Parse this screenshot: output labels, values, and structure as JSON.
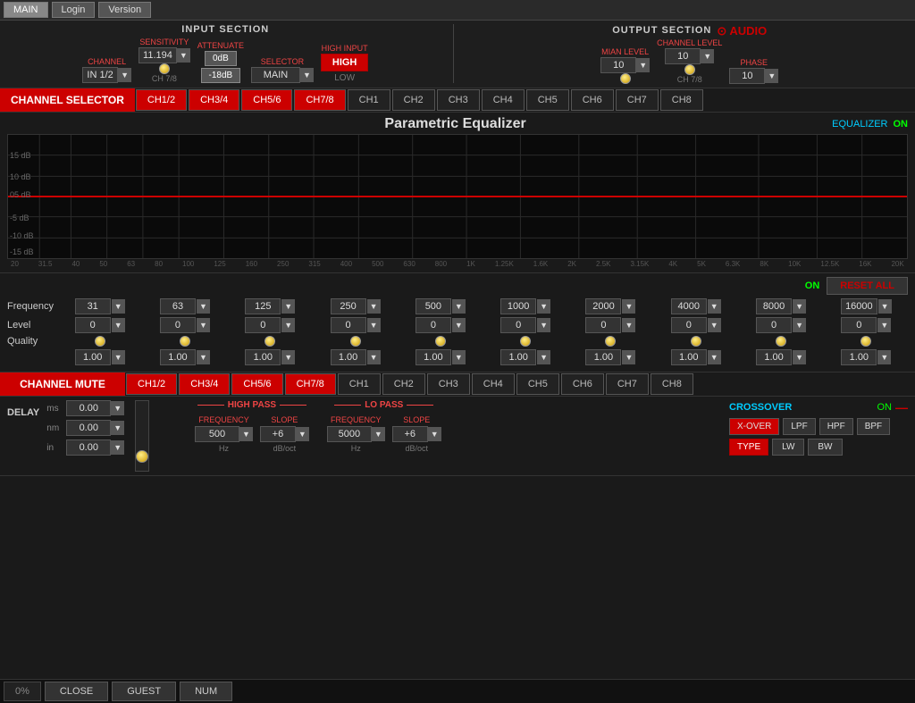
{
  "nav": {
    "main": "MAIN",
    "login": "Login",
    "version": "Version"
  },
  "input_section": {
    "title": "INPUT SECTION",
    "channel_label": "CHANNEL",
    "channel_value": "IN 1/2",
    "sensitivity_label": "SENSITIVITY",
    "sensitivity_value": "11.194",
    "attenuate_label": "ATTENUATE",
    "att_0db": "0dB",
    "att_neg18db": "-18dB",
    "selector_label": "SELECTOR",
    "selector_value": "MAIN",
    "high_input_label": "HIGH INPUT",
    "high_value": "HIGH",
    "low_value": "LOW",
    "ch78_label": "CH 7/8"
  },
  "output_section": {
    "title": "OUTPUT SECTION",
    "audio_logo": "⊙ AUDIO",
    "mian_level_label": "MIAN LEVEL",
    "mian_level_value": "10",
    "channel_level_label": "CHANNEL LEVEL",
    "channel_level_value": "10",
    "phase_label": "PHASE",
    "phase_value": "10",
    "ch78_label": "CH 7/8"
  },
  "channel_selector": {
    "label": "CHANNEL SELECTOR",
    "buttons": [
      "CH1/2",
      "CH3/4",
      "CH5/6",
      "CH7/8",
      "CH1",
      "CH2",
      "CH3",
      "CH4",
      "CH5",
      "CH6",
      "CH7",
      "CH8"
    ]
  },
  "equalizer": {
    "title": "Parametric Equalizer",
    "eq_label": "EQUALIZER",
    "on_label": "ON",
    "freq_labels": [
      "20",
      "31.5",
      "40",
      "50",
      "63",
      "80",
      "100",
      "125",
      "160",
      "250",
      "315",
      "400",
      "500",
      "630",
      "800",
      "1K",
      "1.25K",
      "1.6K",
      "2K",
      "2.5K",
      "3.15K",
      "4K",
      "5K",
      "6.3K",
      "8K",
      "10K",
      "12.5K",
      "16K",
      "20K"
    ],
    "db_labels": [
      "15 dB",
      "10 dB",
      "05 dB",
      "-5 dB",
      "-10 dB",
      "-15 dB"
    ],
    "controls": {
      "on_label": "ON",
      "reset_all": "RESET ALL",
      "frequency_label": "Frequency",
      "frequencies": [
        "31",
        "63",
        "125",
        "250",
        "500",
        "1000",
        "2000",
        "4000",
        "8000",
        "16000"
      ],
      "level_label": "Level",
      "levels": [
        "0",
        "0",
        "0",
        "0",
        "0",
        "0",
        "0",
        "0",
        "0",
        "0"
      ],
      "quality_label": "Quality",
      "qualities": [
        "1.00",
        "1.00",
        "1.00",
        "1.00",
        "1.00",
        "1.00",
        "1.00",
        "1.00",
        "1.00",
        "1.00"
      ]
    }
  },
  "channel_mute": {
    "label": "CHANNEL MUTE",
    "buttons": [
      "CH1/2",
      "CH3/4",
      "CH5/6",
      "CH7/8",
      "CH1",
      "CH2",
      "CH3",
      "CH4",
      "CH5",
      "CH6",
      "CH7",
      "CH8"
    ]
  },
  "delay": {
    "label": "DELAY",
    "ms_label": "ms",
    "ms_value": "0.00",
    "nm_label": "nm",
    "nm_value": "0.00",
    "in_label": "in",
    "in_value": "0.00"
  },
  "high_pass": {
    "title": "HIGH PASS",
    "freq_label": "FREQUENCY",
    "freq_value": "500",
    "freq_unit": "Hz",
    "slope_label": "SLOPE",
    "slope_value": "+6",
    "slope_unit": "dB/oct"
  },
  "lo_pass": {
    "title": "LO PASS",
    "freq_label": "FREQUENCY",
    "freq_value": "5000",
    "freq_unit": "Hz",
    "slope_label": "SLOPE",
    "slope_value": "+6",
    "slope_unit": "dB/oct"
  },
  "crossover": {
    "title": "CROSSOVER",
    "on_label": "ON",
    "xover_btn": "X-OVER",
    "lpf_btn": "LPF",
    "hpf_btn": "HPF",
    "bpf_btn": "BPF",
    "type_btn": "TYPE",
    "lw_btn": "LW",
    "bw_btn": "BW"
  },
  "status_bar": {
    "percent": "0%",
    "close": "CLOSE",
    "guest": "GUEST",
    "num": "NUM"
  }
}
